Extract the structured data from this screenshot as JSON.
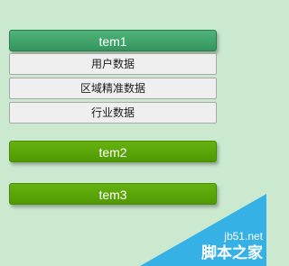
{
  "menu": [
    {
      "title": "tem1",
      "expanded": true,
      "items": [
        "用户数据",
        "区域精准数据",
        "行业数据"
      ]
    },
    {
      "title": "tem2",
      "expanded": false
    },
    {
      "title": "tem3",
      "expanded": false
    }
  ],
  "watermark": {
    "site": "jb51.net",
    "name": "脚本之家"
  },
  "colors": {
    "background": "#cbe9cf",
    "active_header": "#3fa66b",
    "collapsed_header": "#5aa806",
    "submenu_bg": "#efefef",
    "watermark": "#35b1e6"
  }
}
